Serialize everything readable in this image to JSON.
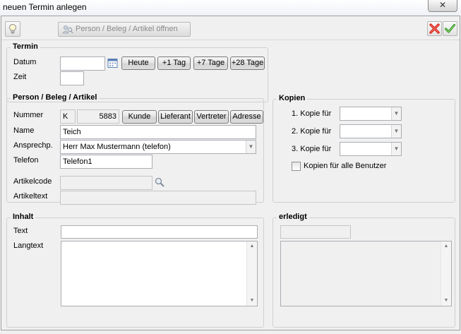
{
  "window": {
    "title": "neuen Termin anlegen",
    "close_glyph": "✕"
  },
  "toolbar": {
    "open_label": "Person / Beleg / Artikel öffnen"
  },
  "termin": {
    "legend": "Termin",
    "datum_label": "Datum",
    "datum_value": "",
    "zeit_label": "Zeit",
    "zeit_value": "",
    "btn_heute": "Heute",
    "btn_1tag": "+1 Tag",
    "btn_7tage": "+7 Tage",
    "btn_28tage": "+28 Tage"
  },
  "person": {
    "legend": "Person / Beleg / Artikel",
    "nummer_label": "Nummer",
    "nummer_prefix": "K",
    "nummer_value": "5883",
    "btn_kunde": "Kunde",
    "btn_lieferant": "Lieferant",
    "btn_vertreter": "Vertreter",
    "btn_adresse": "Adresse",
    "name_label": "Name",
    "name_value": "Teich",
    "ansprech_label": "Ansprechp.",
    "ansprech_value": "Herr Max Mustermann (telefon)",
    "telefon_label": "Telefon",
    "telefon_value": "Telefon1",
    "artikelcode_label": "Artikelcode",
    "artikelcode_value": "",
    "artikeltext_label": "Artikeltext",
    "artikeltext_value": ""
  },
  "kopien": {
    "legend": "Kopien",
    "kopie1_label": "1. Kopie für",
    "kopie2_label": "2. Kopie für",
    "kopie3_label": "3. Kopie für",
    "kopie1_value": "",
    "kopie2_value": "",
    "kopie3_value": "",
    "all_users_label": "Kopien für alle Benutzer",
    "all_users_checked": false
  },
  "inhalt": {
    "legend": "Inhalt",
    "text_label": "Text",
    "text_value": "",
    "langtext_label": "Langtext",
    "langtext_value": ""
  },
  "erledigt": {
    "legend": "erledigt",
    "value": "",
    "notes": ""
  },
  "icons": {
    "hint": "lightbulb-icon",
    "open": "person-search-icon",
    "cancel": "red-x-icon",
    "ok": "green-check-icon",
    "calendar": "calendar-icon",
    "search": "magnifier-icon",
    "dropdown": "chevron-down-icon"
  },
  "colors": {
    "cancel_red": "#d9261c",
    "ok_green": "#3a9a2c",
    "group_border": "#d0d0d0",
    "window_bg": "#f0f0f0"
  }
}
